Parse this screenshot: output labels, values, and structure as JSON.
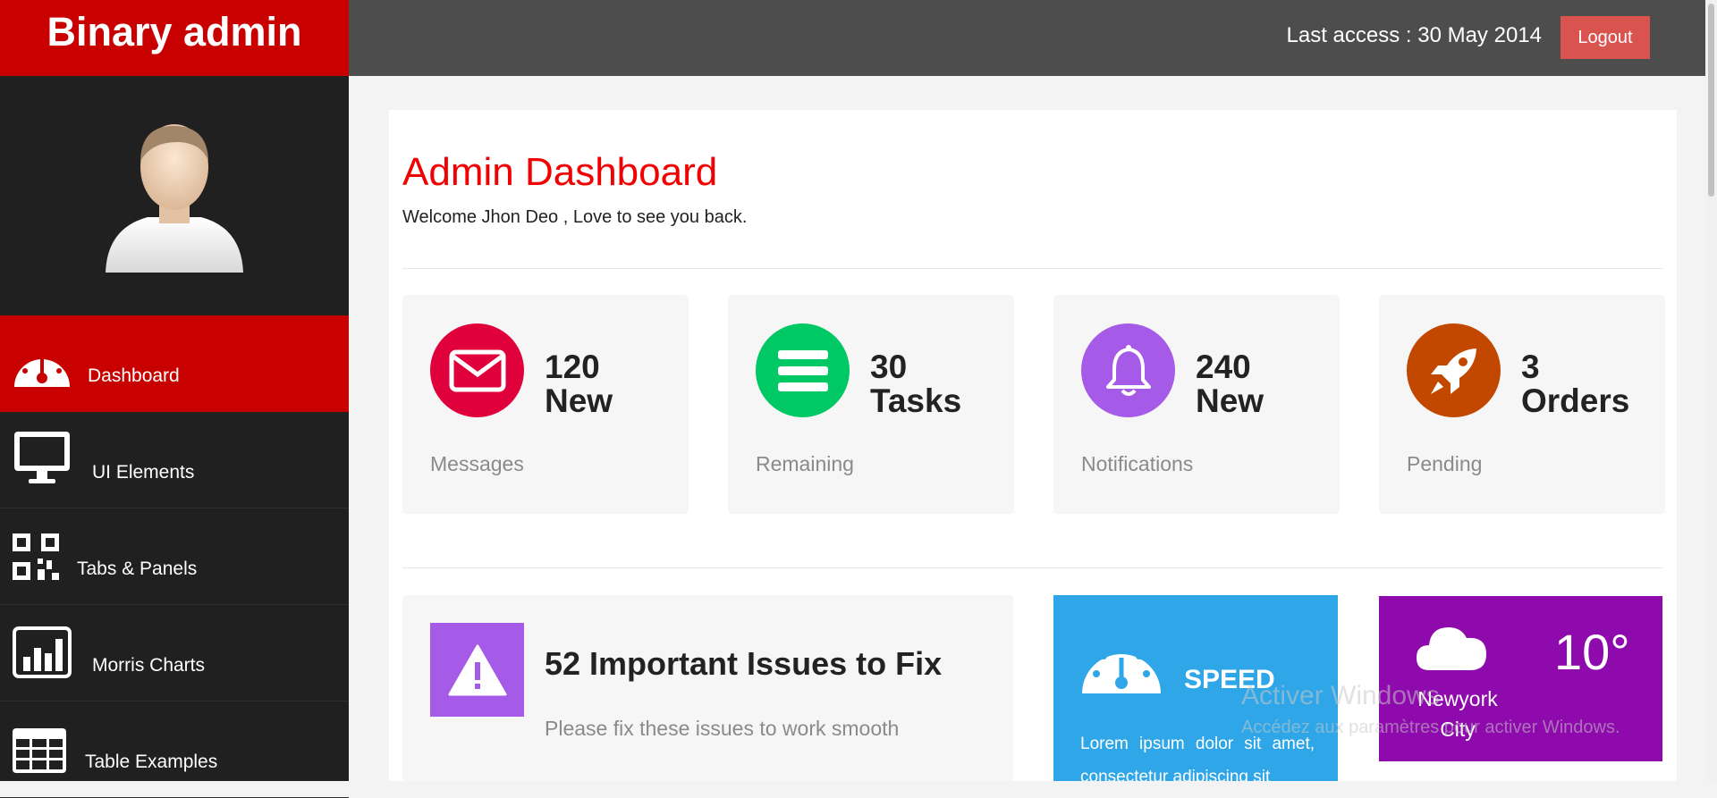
{
  "header": {
    "brand": "Binary admin",
    "last_access": "Last access : 30 May 2014",
    "logout_label": "Logout"
  },
  "sidebar": {
    "items": [
      {
        "label": "Dashboard",
        "icon": "dashboard-icon",
        "active": true
      },
      {
        "label": "UI Elements",
        "icon": "desktop-icon"
      },
      {
        "label": "Tabs & Panels",
        "icon": "qrcode-icon"
      },
      {
        "label": "Morris Charts",
        "icon": "bar-chart-icon"
      },
      {
        "label": "Table Examples",
        "icon": "table-icon"
      }
    ]
  },
  "main": {
    "title": "Admin Dashboard",
    "welcome": "Welcome Jhon Deo , Love to see you back.",
    "stats": [
      {
        "line1": "120",
        "line2": "New",
        "sub": "Messages",
        "color": "#e0003b",
        "icon": "envelope-icon"
      },
      {
        "line1": "30",
        "line2": "Tasks",
        "sub": "Remaining",
        "color": "#00c864",
        "icon": "bars-icon"
      },
      {
        "line1": "240",
        "line2": "New",
        "sub": "Notifications",
        "color": "#a55ae8",
        "icon": "bell-icon"
      },
      {
        "line1": "3",
        "line2": "Orders",
        "sub": "Pending",
        "color": "#c24800",
        "icon": "rocket-icon"
      }
    ],
    "issues": {
      "title": "52 Important Issues to Fix",
      "subtitle": "Please fix these issues to work smooth",
      "color": "#a55ae8",
      "icon": "warning-icon"
    },
    "speed": {
      "title": "SPEED",
      "text": "Lorem ipsum dolor sit amet, consectetur adipiscing sit",
      "color": "#2ea6e8",
      "icon": "dashboard-icon"
    },
    "weather": {
      "temp": "10°",
      "city": "Newyork City",
      "color": "#8e0aac",
      "icon": "cloud-icon"
    }
  },
  "watermark": {
    "line1": "Activer Windows",
    "line2": "Accédez aux paramètres pour activer Windows."
  }
}
